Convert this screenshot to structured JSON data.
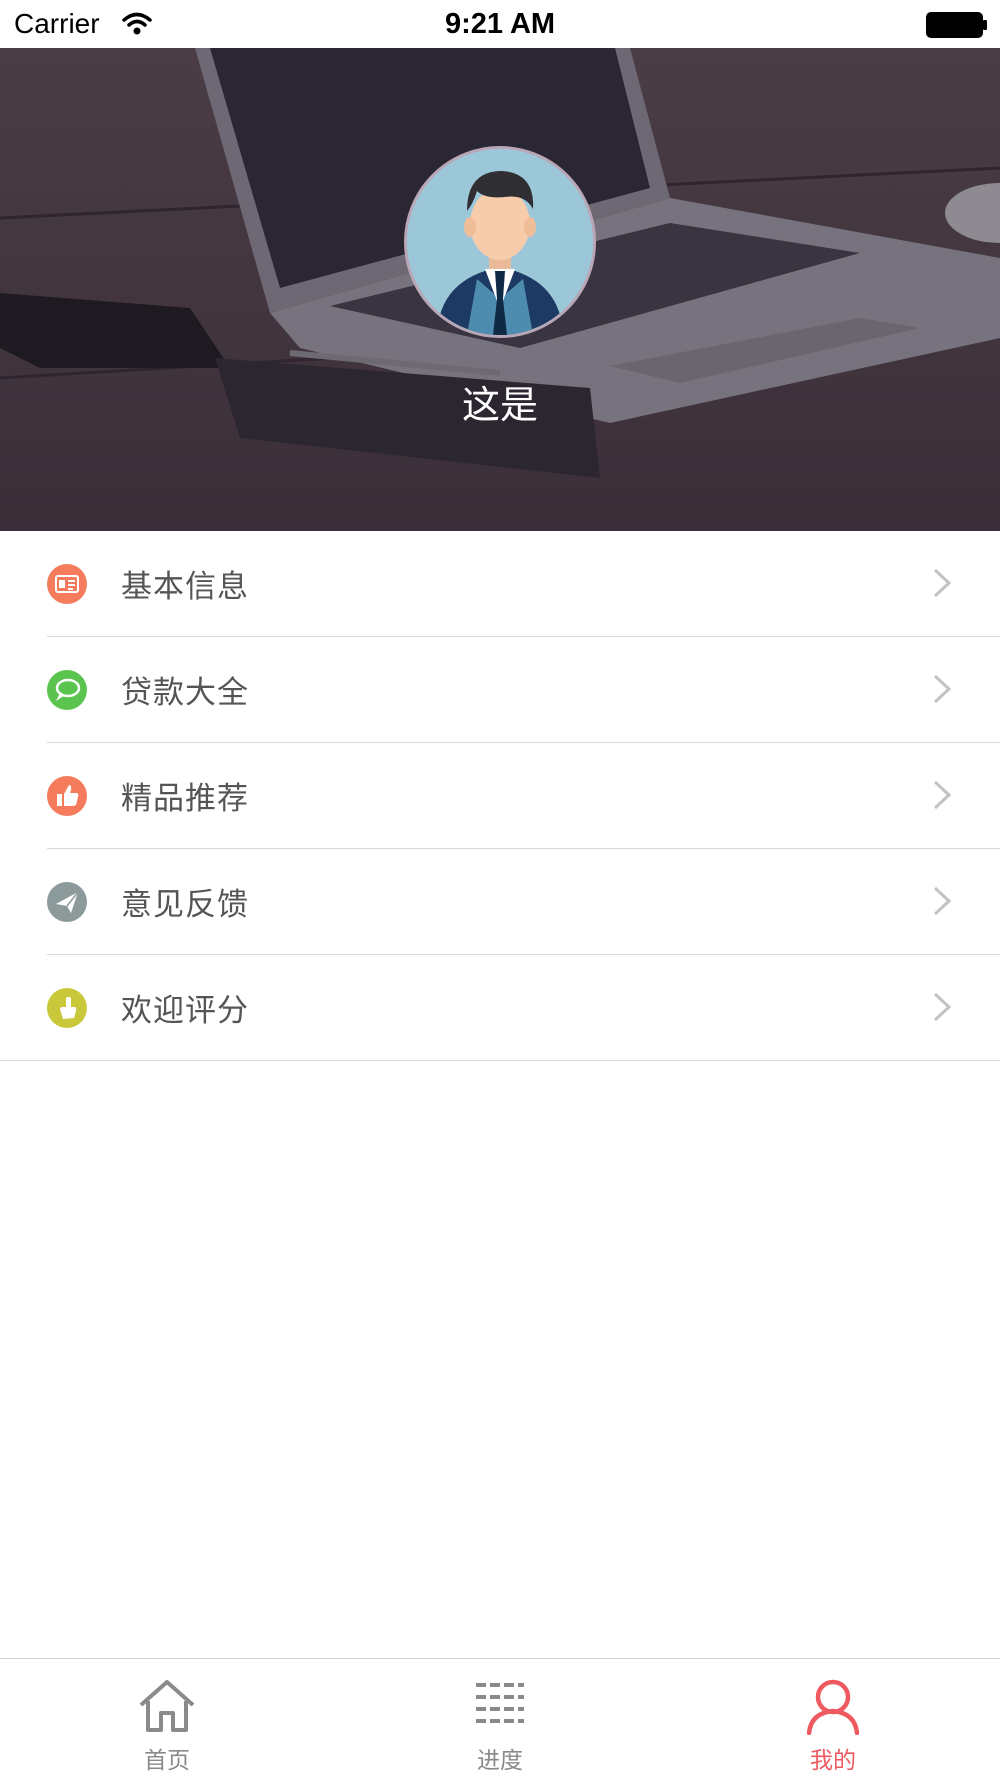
{
  "status_bar": {
    "carrier": "Carrier",
    "time": "9:21 AM"
  },
  "profile": {
    "name": "这是"
  },
  "menu": {
    "items": [
      {
        "label": "基本信息",
        "icon": "id-card-icon",
        "color": "#f47b5c"
      },
      {
        "label": "贷款大全",
        "icon": "chat-bubble-icon",
        "color": "#5bc44f"
      },
      {
        "label": "精品推荐",
        "icon": "thumbs-up-icon",
        "color": "#f47b5c"
      },
      {
        "label": "意见反馈",
        "icon": "envelope-icon",
        "color": "#8d9a9c"
      },
      {
        "label": "欢迎评分",
        "icon": "pointer-hand-icon",
        "color": "#c9c83a"
      }
    ]
  },
  "tabbar": {
    "tabs": [
      {
        "label": "首页",
        "icon": "home-icon"
      },
      {
        "label": "进度",
        "icon": "list-icon"
      },
      {
        "label": "我的",
        "icon": "user-icon",
        "active": true
      }
    ],
    "active_color": "#ee5a5f",
    "inactive_color": "#8a8a8a"
  }
}
